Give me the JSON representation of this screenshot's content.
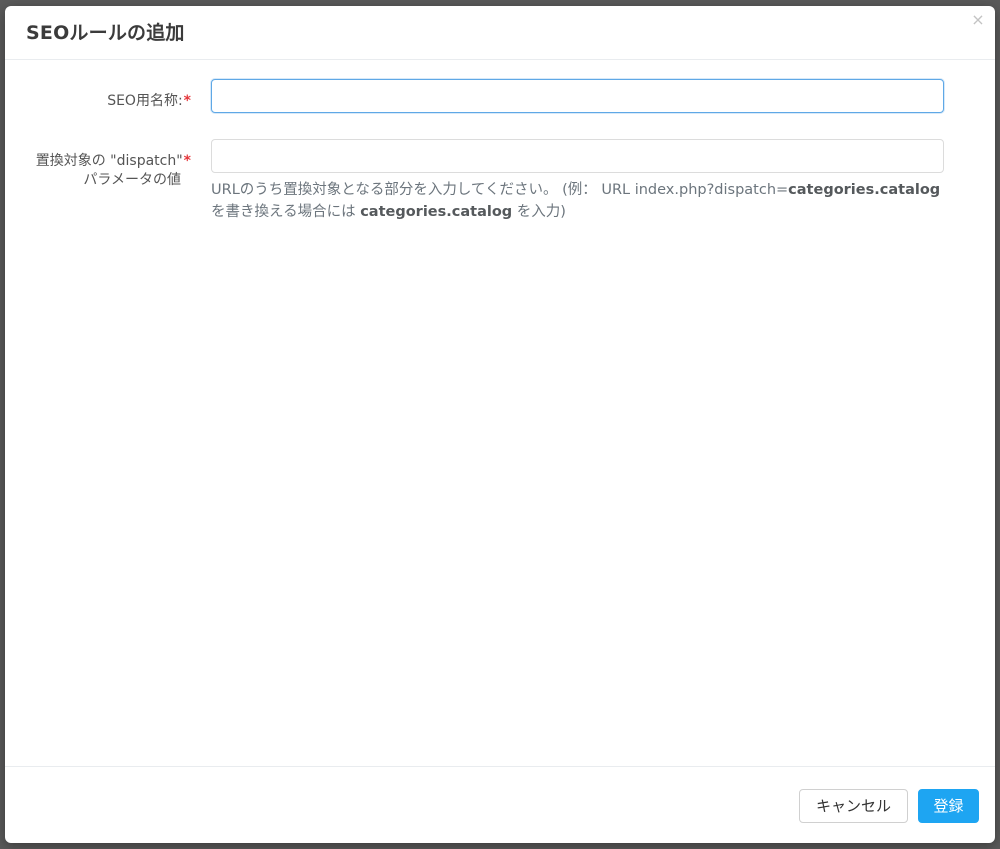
{
  "dialog": {
    "title": "SEOルールの追加",
    "close_symbol": "×"
  },
  "form": {
    "seo_name": {
      "label": "SEO用名称:",
      "required_mark": "*",
      "value": "",
      "placeholder": ""
    },
    "dispatch": {
      "label_line1": "置換対象の \"dispatch\"",
      "label_line2": "パラメータの値",
      "required_mark": "*",
      "value": "",
      "placeholder": "",
      "help_part1": "URLのうち置換対象となる部分を入力してください。 (例： URL index.php?dispatch=",
      "help_bold1": "categories.catalog",
      "help_part2": "を書き換える場合には ",
      "help_bold2": "categories.catalog",
      "help_part3": " を入力)"
    }
  },
  "footer": {
    "cancel_label": "キャンセル",
    "submit_label": "登録"
  },
  "colors": {
    "primary": "#1ea5f2",
    "required": "#e5373c",
    "focus_border": "#5fa8e6"
  }
}
